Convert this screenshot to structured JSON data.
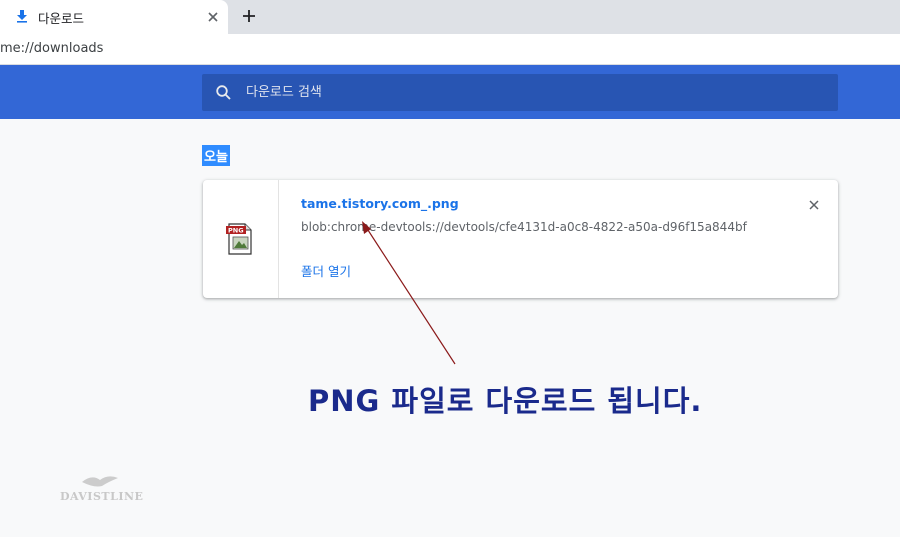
{
  "tab": {
    "title": "다운로드"
  },
  "address_bar": {
    "url": "me://downloads"
  },
  "search": {
    "placeholder": "다운로드 검색"
  },
  "section": {
    "date_label": "오늘"
  },
  "download_item": {
    "file_name": "tame.tistory.com_.png",
    "source_url": "blob:chrome-devtools://devtools/cfe4131d-a0c8-4822-a50a-d96f15a844bf",
    "action_label": "폴더 열기",
    "file_type_label": "PNG"
  },
  "annotation": {
    "text": "PNG 파일로 다운로드 됩니다."
  },
  "watermark": {
    "text": "DAVISTLINE"
  },
  "colors": {
    "header_blue": "#3367d6",
    "search_bg": "#2855b3",
    "link_blue": "#1a73e8",
    "annotation": "#1a2a8c",
    "arrow": "#8b1a1a"
  },
  "icons": {
    "tab": "download-icon",
    "tab_close": "close-icon",
    "new_tab": "plus-icon",
    "search": "search-icon",
    "file": "png-file-icon",
    "remove": "close-icon"
  }
}
